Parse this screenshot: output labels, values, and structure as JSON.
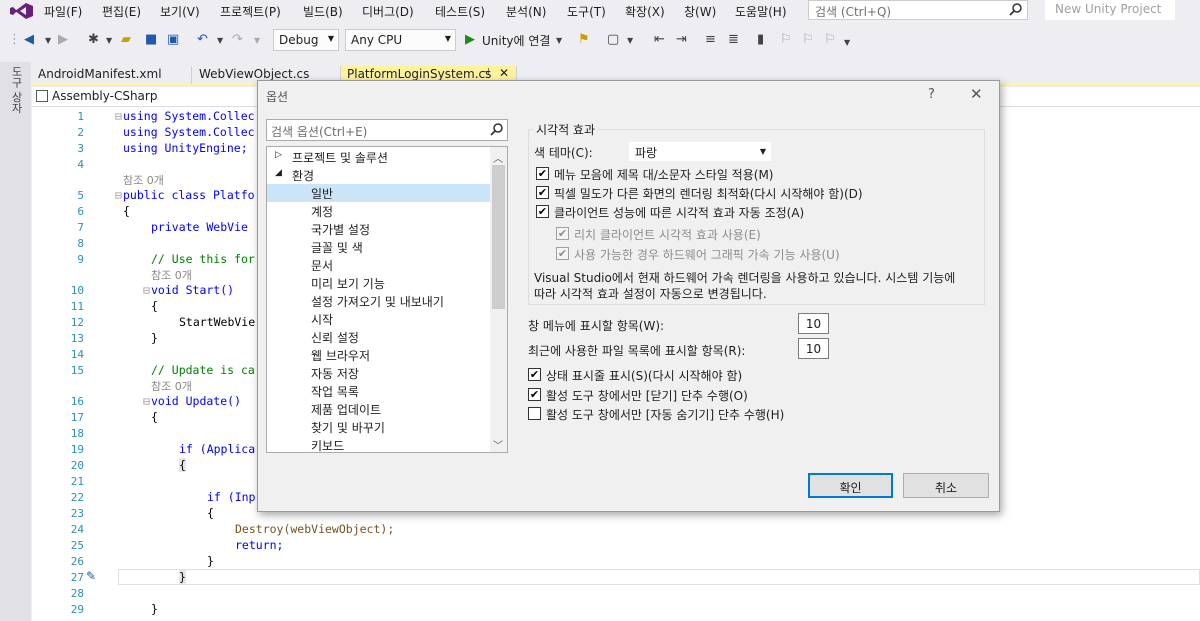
{
  "menubar": {
    "items": [
      "파일(F)",
      "편집(E)",
      "보기(V)",
      "프로젝트(P)",
      "빌드(B)",
      "디버그(D)",
      "테스트(S)",
      "분석(N)",
      "도구(T)",
      "확장(X)",
      "창(W)",
      "도움말(H)"
    ],
    "search_placeholder": "검색 (Ctrl+Q)",
    "project_label": "New Unity Project"
  },
  "toolbar": {
    "configuration": "Debug",
    "platform": "Any CPU",
    "run_label": "Unity에 연결"
  },
  "toolstrip": {
    "label": "도구 상자"
  },
  "tabs": [
    {
      "label": "AndroidManifest.xml"
    },
    {
      "label": "WebViewObject.cs"
    },
    {
      "label": "PlatformLoginSystem.cs"
    }
  ],
  "navbar": {
    "assembly": "Assembly-CSharp"
  },
  "editor": {
    "line_numbers": [
      "1",
      "2",
      "3",
      "4",
      "5",
      "6",
      "7",
      "8",
      "9",
      "10",
      "11",
      "12",
      "13",
      "14",
      "15",
      "16",
      "17",
      "18",
      "19",
      "20",
      "21",
      "22",
      "23",
      "24",
      "25",
      "26",
      "27",
      "28",
      "29"
    ],
    "refs": {
      "r1": "참조 0개",
      "r2": "참조 0개",
      "r3": "참조 0개"
    },
    "lines": {
      "l1": "using System.Collec",
      "l2": "using System.Collec",
      "l3": "using UnityEngine;",
      "l5": "public class Platfo",
      "l6": "{",
      "l7": "private WebVie",
      "l9": "// Use this for",
      "l10": "void Start()",
      "l11": "{",
      "l12": "StartWebVie",
      "l13": "}",
      "l15": "// Update is ca",
      "l16": "void Update()",
      "l17": "{",
      "l19": "if (Applica",
      "l20": "{",
      "l22": "if (Inp",
      "l23": "{",
      "l24": "Destroy(webViewObject);",
      "l25": "return;",
      "l26": "}",
      "l27": "}",
      "l29": "}"
    }
  },
  "dialog": {
    "title": "옵션",
    "help": "?",
    "close": "✕",
    "search_placeholder": "검색 옵션(Ctrl+E)",
    "tree": {
      "projects": "프로젝트 및 솔루션",
      "env": "환경",
      "children": [
        "일반",
        "계정",
        "국가별 설정",
        "글꼴 및 색",
        "문서",
        "미리 보기 기능",
        "설정 가져오기 및 내보내기",
        "시작",
        "신뢰 설정",
        "웹 브라우저",
        "자동 저장",
        "작업 목록",
        "제품 업데이트",
        "찾기 및 바꾸기",
        "키보드"
      ]
    },
    "visual": {
      "group_title": "시각적 효과",
      "theme_label": "색 테마(C):",
      "theme_value": "파랑",
      "opt1": "메뉴 모음에 제목 대/소문자 스타일 적용(M)",
      "opt2": "픽셀 밀도가 다른 화면의 렌더링 최적화(다시 시작해야 함)(D)",
      "opt3": "클라이언트 성능에 따른 시각적 효과 자동 조정(A)",
      "opt4": "리치 클라이언트 시각적 효과 사용(E)",
      "opt5": "사용 가능한 경우 하드웨어 그래픽 가속 기능 사용(U)",
      "info1": "Visual Studio에서 현재 하드웨어 가속 렌더링을 사용하고 있습니다. 시스템 기능에",
      "info2": "따라 시각적 효과 설정이 자동으로 변경됩니다."
    },
    "window_menu_label": "창 메뉴에 표시할 항목(W):",
    "window_menu_value": "10",
    "recent_label": "최근에 사용한 파일 목록에 표시할 항목(R):",
    "recent_value": "10",
    "status_bar": "상태 표시줄 표시(S)(다시 시작해야 함)",
    "close_active": "활성 도구 창에서만 [닫기] 단추 수행(O)",
    "autohide_active": "활성 도구 창에서만 [자동 숨기기] 단추 수행(H)",
    "ok": "확인",
    "cancel": "취소"
  }
}
